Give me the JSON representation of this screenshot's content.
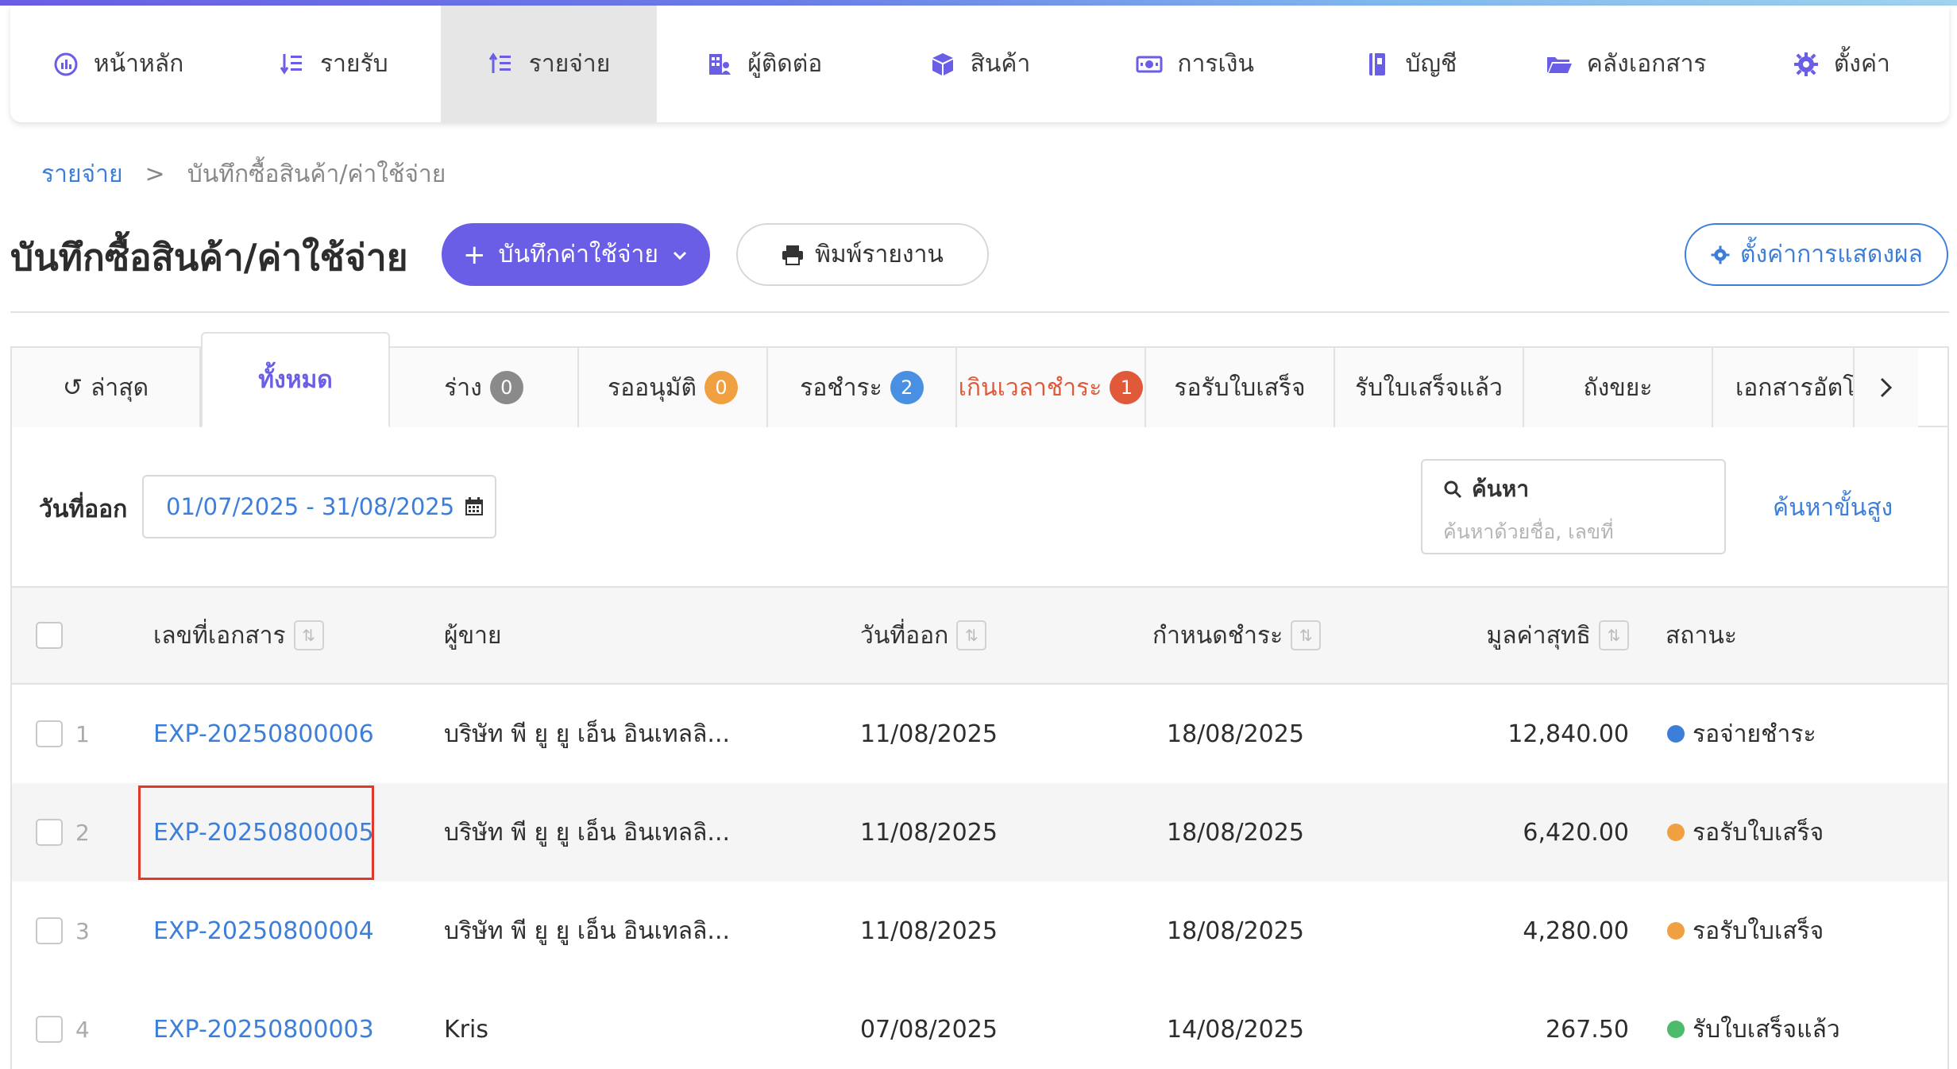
{
  "nav": {
    "items": [
      {
        "label": "หน้าหลัก",
        "icon": "dashboard-icon"
      },
      {
        "label": "รายรับ",
        "icon": "income-list-icon"
      },
      {
        "label": "รายจ่าย",
        "icon": "expense-list-icon",
        "active": true
      },
      {
        "label": "ผู้ติดต่อ",
        "icon": "contacts-icon"
      },
      {
        "label": "สินค้า",
        "icon": "box-icon"
      },
      {
        "label": "การเงิน",
        "icon": "money-icon"
      },
      {
        "label": "บัญชี",
        "icon": "book-icon"
      },
      {
        "label": "คลังเอกสาร",
        "icon": "folder-icon"
      },
      {
        "label": "ตั้งค่า",
        "icon": "gear-icon"
      }
    ]
  },
  "breadcrumb": {
    "parent": "รายจ่าย",
    "separator": ">",
    "current": "บันทึกซื้อสินค้า/ค่าใช้จ่าย"
  },
  "page": {
    "title": "บันทึกซื้อสินค้า/ค่าใช้จ่าย",
    "add_button": "บันทึกค่าใช้จ่าย",
    "print_button": "พิมพ์รายงาน",
    "display_settings_button": "ตั้งค่าการแสดงผล"
  },
  "tabs": [
    {
      "label": "ล่าสุด"
    },
    {
      "label": "ทั้งหมด",
      "active": true
    },
    {
      "label": "ร่าง",
      "badge": "0",
      "badge_color": "#8a8a8a"
    },
    {
      "label": "รออนุมัติ",
      "badge": "0",
      "badge_color": "#f0a040"
    },
    {
      "label": "รอชำระ",
      "badge": "2",
      "badge_color": "#4a90e2"
    },
    {
      "label": "เกินเวลาชำระ",
      "badge": "1",
      "badge_color": "#e05a3a",
      "overdue": true
    },
    {
      "label": "รอรับใบเสร็จ"
    },
    {
      "label": "รับใบเสร็จแล้ว"
    },
    {
      "label": "ถังขยะ"
    },
    {
      "label": "เอกสารอัตโนมัติ"
    }
  ],
  "filter": {
    "date_label": "วันที่ออก",
    "date_range": "01/07/2025 - 31/08/2025",
    "search_title": "ค้นหา",
    "search_placeholder": "ค้นหาด้วยชื่อ, เลขที่",
    "advanced_search": "ค้นหาขั้นสูง"
  },
  "table": {
    "headers": {
      "doc_no": "เลขที่เอกสาร",
      "vendor": "ผู้ขาย",
      "issue_date": "วันที่ออก",
      "due_date": "กำหนดชำระ",
      "net_amount": "มูลค่าสุทธิ",
      "status": "สถานะ"
    },
    "rows": [
      {
        "num": "1",
        "doc_no": "EXP-20250800006",
        "vendor": "บริษัท พี ยู ยู เอ็น อินเทลลิ...",
        "issue_date": "11/08/2025",
        "due_date": "18/08/2025",
        "net_amount": "12,840.00",
        "status": "รอจ่ายชำระ",
        "status_color": "#3d7fd8"
      },
      {
        "num": "2",
        "doc_no": "EXP-20250800005",
        "vendor": "บริษัท พี ยู ยู เอ็น อินเทลลิ...",
        "issue_date": "11/08/2025",
        "due_date": "18/08/2025",
        "net_amount": "6,420.00",
        "status": "รอรับใบเสร็จ",
        "status_color": "#f0a040"
      },
      {
        "num": "3",
        "doc_no": "EXP-20250800004",
        "vendor": "บริษัท พี ยู ยู เอ็น อินเทลลิ...",
        "issue_date": "11/08/2025",
        "due_date": "18/08/2025",
        "net_amount": "4,280.00",
        "status": "รอรับใบเสร็จ",
        "status_color": "#f0a040"
      },
      {
        "num": "4",
        "doc_no": "EXP-20250800003",
        "vendor": "Kris",
        "issue_date": "07/08/2025",
        "due_date": "14/08/2025",
        "net_amount": "267.50",
        "status": "รับใบเสร็จแล้ว",
        "status_color": "#4cbb6c"
      }
    ]
  },
  "colors": {
    "accent": "#6a5de6",
    "link": "#3d7fd8",
    "highlight": "#e0392b"
  }
}
